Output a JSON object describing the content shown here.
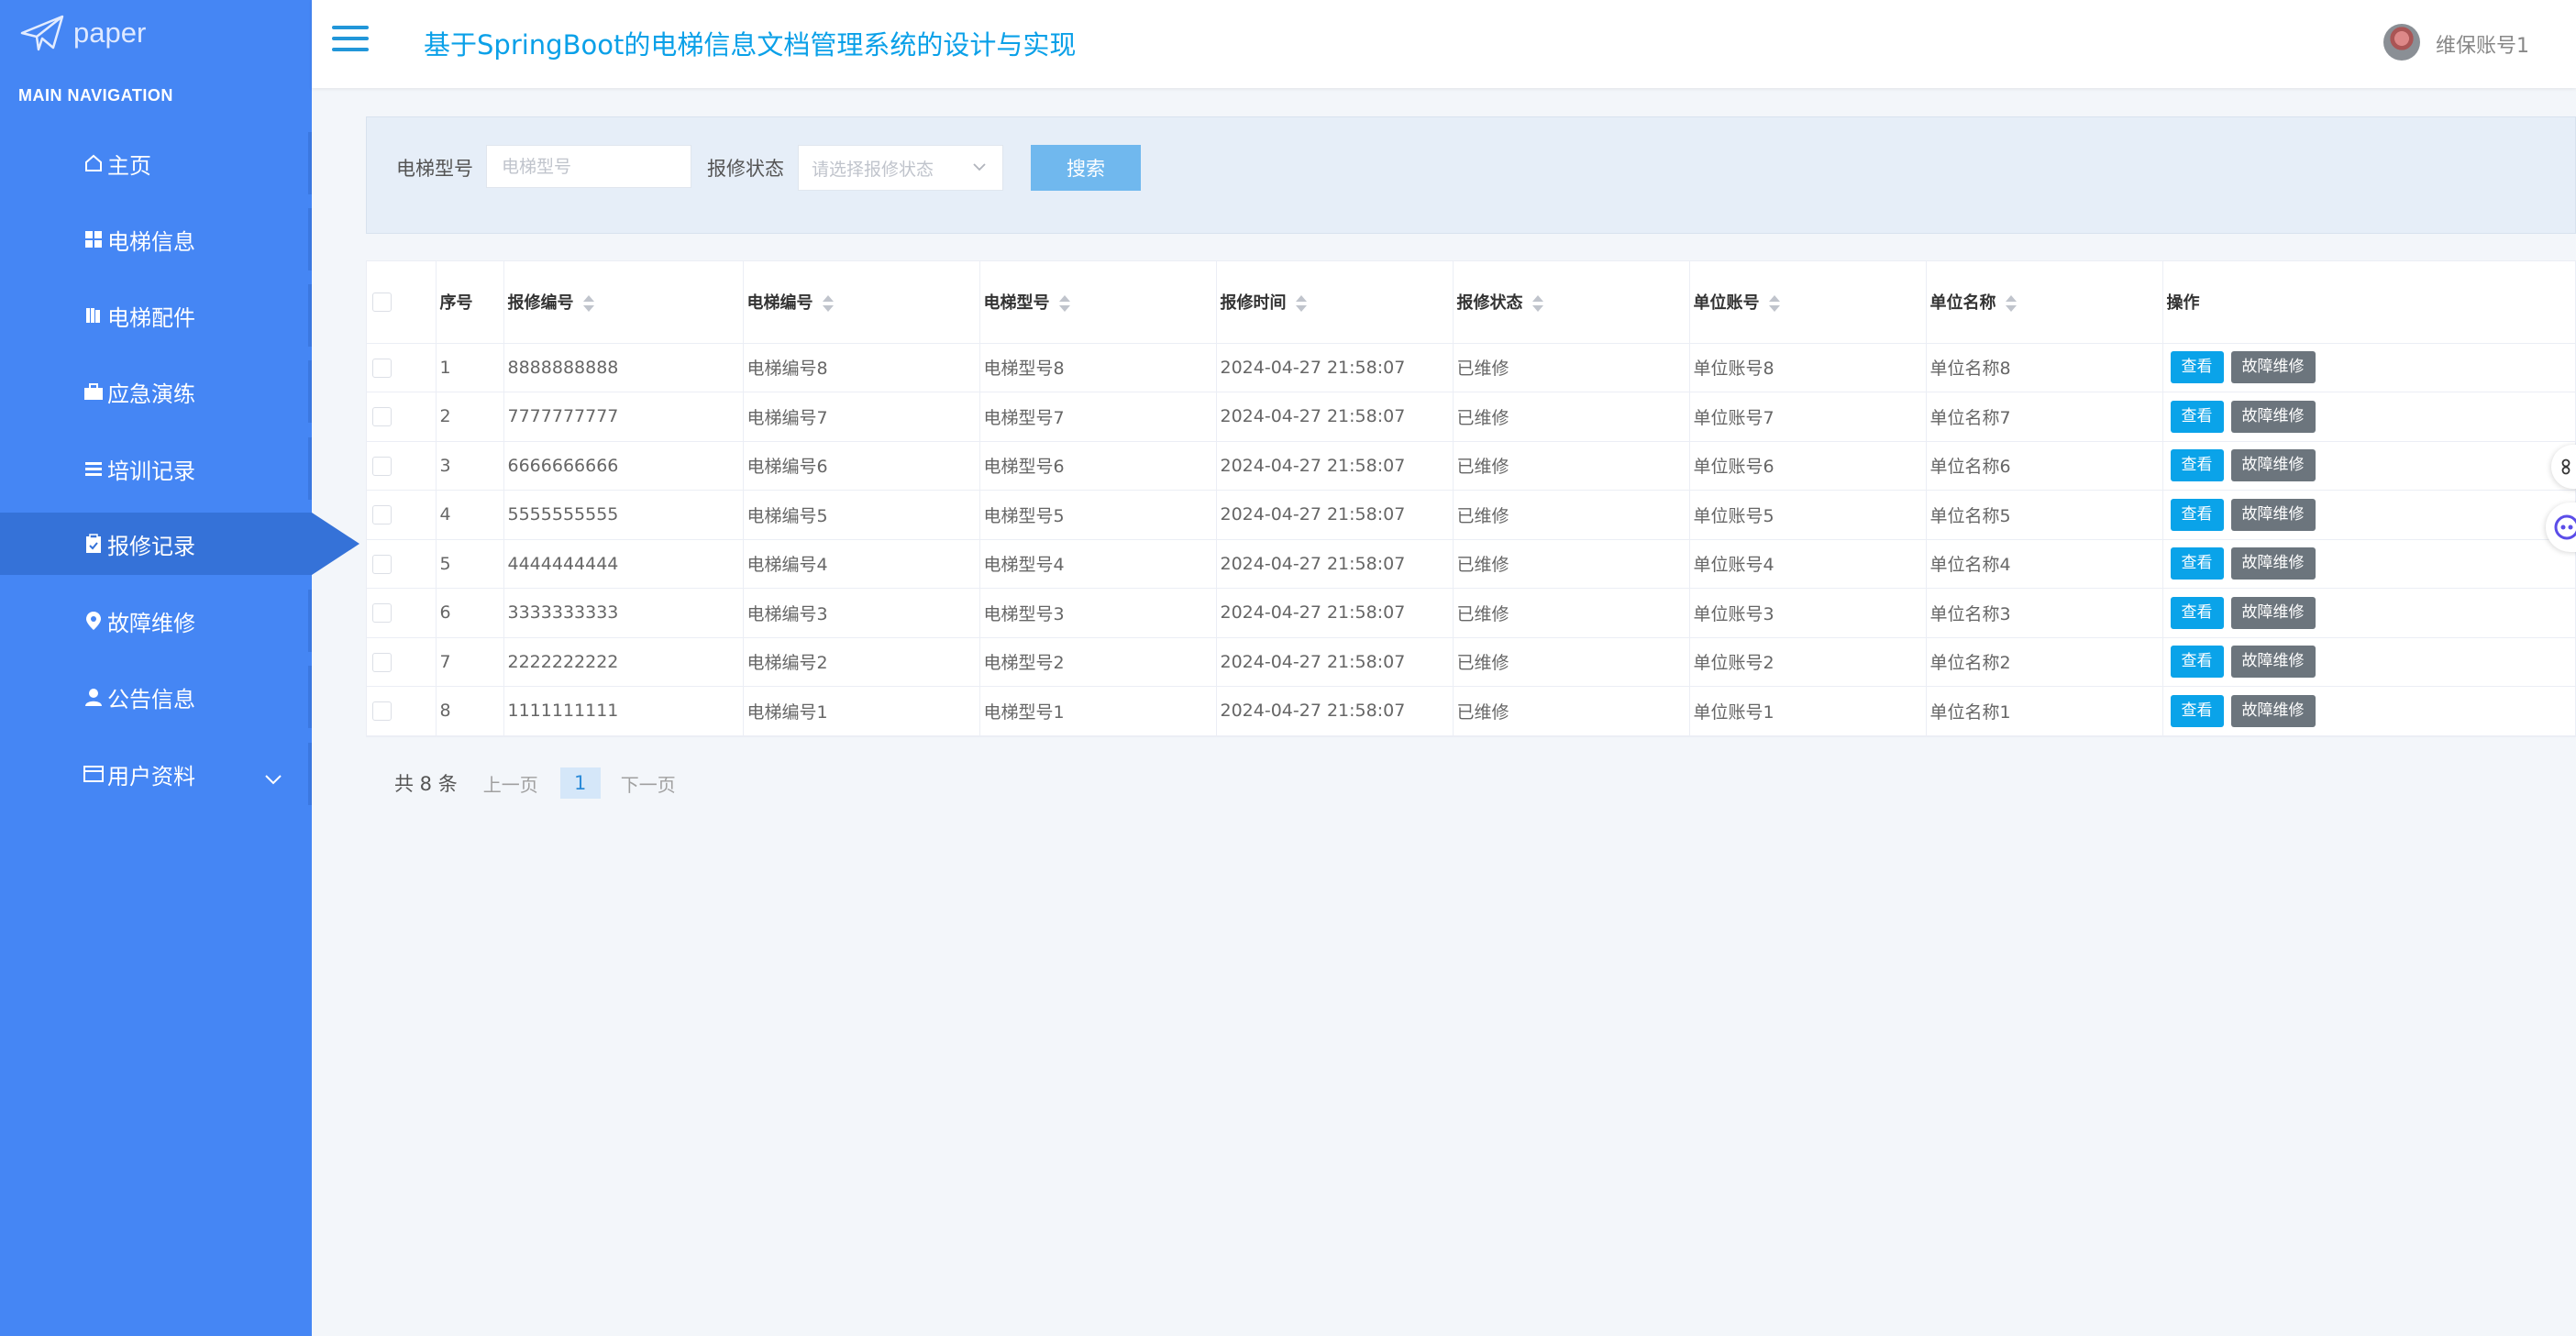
{
  "logo": {
    "text": "paper"
  },
  "nav": {
    "heading": "MAIN NAVIGATION",
    "items": [
      {
        "label": "主页",
        "icon": "home-icon"
      },
      {
        "label": "电梯信息",
        "icon": "grid-icon"
      },
      {
        "label": "电梯配件",
        "icon": "book-icon"
      },
      {
        "label": "应急演练",
        "icon": "briefcase-icon"
      },
      {
        "label": "培训记录",
        "icon": "list-icon"
      },
      {
        "label": "报修记录",
        "icon": "clipboard-icon",
        "active": true
      },
      {
        "label": "故障维修",
        "icon": "location-pin-icon"
      },
      {
        "label": "公告信息",
        "icon": "user-icon"
      },
      {
        "label": "用户资料",
        "icon": "id-card-icon",
        "expandable": true
      }
    ]
  },
  "header": {
    "title": "基于SpringBoot的电梯信息文档管理系统的设计与实现",
    "user_name": "维保账号1"
  },
  "search": {
    "model_label": "电梯型号",
    "model_placeholder": "电梯型号",
    "status_label": "报修状态",
    "status_placeholder": "请选择报修状态",
    "button_label": "搜索"
  },
  "table": {
    "columns": [
      "序号",
      "报修编号",
      "电梯编号",
      "电梯型号",
      "报修时间",
      "报修状态",
      "单位账号",
      "单位名称",
      "操作"
    ],
    "sortable": [
      false,
      true,
      true,
      true,
      true,
      true,
      true,
      true,
      false
    ],
    "view_label": "查看",
    "repair_label": "故障维修",
    "rows": [
      [
        "1",
        "8888888888",
        "电梯编号8",
        "电梯型号8",
        "2024-04-27 21:58:07",
        "已维修",
        "单位账号8",
        "单位名称8"
      ],
      [
        "2",
        "7777777777",
        "电梯编号7",
        "电梯型号7",
        "2024-04-27 21:58:07",
        "已维修",
        "单位账号7",
        "单位名称7"
      ],
      [
        "3",
        "6666666666",
        "电梯编号6",
        "电梯型号6",
        "2024-04-27 21:58:07",
        "已维修",
        "单位账号6",
        "单位名称6"
      ],
      [
        "4",
        "5555555555",
        "电梯编号5",
        "电梯型号5",
        "2024-04-27 21:58:07",
        "已维修",
        "单位账号5",
        "单位名称5"
      ],
      [
        "5",
        "4444444444",
        "电梯编号4",
        "电梯型号4",
        "2024-04-27 21:58:07",
        "已维修",
        "单位账号4",
        "单位名称4"
      ],
      [
        "6",
        "3333333333",
        "电梯编号3",
        "电梯型号3",
        "2024-04-27 21:58:07",
        "已维修",
        "单位账号3",
        "单位名称3"
      ],
      [
        "7",
        "2222222222",
        "电梯编号2",
        "电梯型号2",
        "2024-04-27 21:58:07",
        "已维修",
        "单位账号2",
        "单位名称2"
      ],
      [
        "8",
        "1111111111",
        "电梯编号1",
        "电梯型号1",
        "2024-04-27 21:58:07",
        "已维修",
        "单位账号1",
        "单位名称1"
      ]
    ]
  },
  "pagination": {
    "total": "共 8 条",
    "prev": "上一页",
    "current": "1",
    "next": "下一页"
  },
  "colors": {
    "sidebar": "#4586f4",
    "sidebar_active": "#3572d8",
    "accent": "#0aa3e9",
    "title": "#0aa0e8"
  }
}
